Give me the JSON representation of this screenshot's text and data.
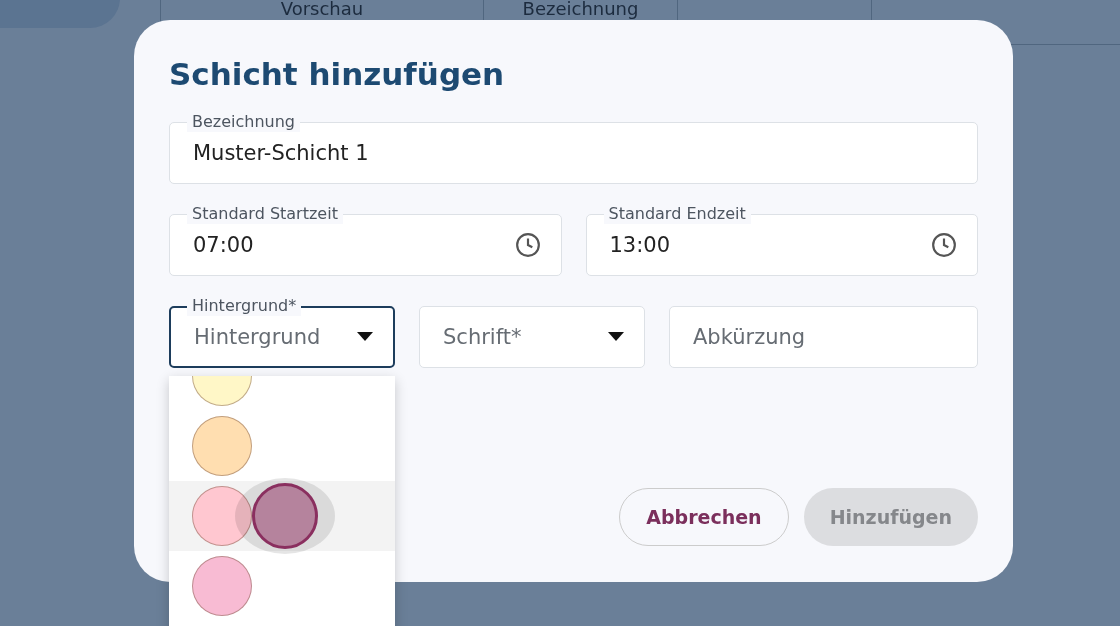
{
  "background_table": {
    "columns": [
      "Vorschau",
      "Bezeichnung"
    ]
  },
  "dialog": {
    "title": "Schicht hinzufügen",
    "name_field": {
      "label": "Bezeichnung",
      "value": "Muster-Schicht 1"
    },
    "start_field": {
      "label": "Standard Startzeit",
      "value": "07:00"
    },
    "end_field": {
      "label": "Standard Endzeit",
      "value": "13:00"
    },
    "background_select": {
      "label": "Hintergrund*",
      "value": "Hintergrund",
      "expanded": true
    },
    "font_select": {
      "placeholder": "Schrift*"
    },
    "abbreviation_field": {
      "placeholder": "Abkürzung"
    },
    "buttons": [
      {
        "label": "Abbrechen",
        "disabled": false
      },
      {
        "label": "Hinzufügen",
        "disabled": true
      }
    ]
  },
  "color_options": [
    {
      "color": "#fff7c7",
      "selected": false
    },
    {
      "color": "#ffdeb0",
      "selected": false
    },
    {
      "color": "#ffc7d0",
      "selected": true
    },
    {
      "color": "#f8bbd3",
      "selected": false
    }
  ]
}
